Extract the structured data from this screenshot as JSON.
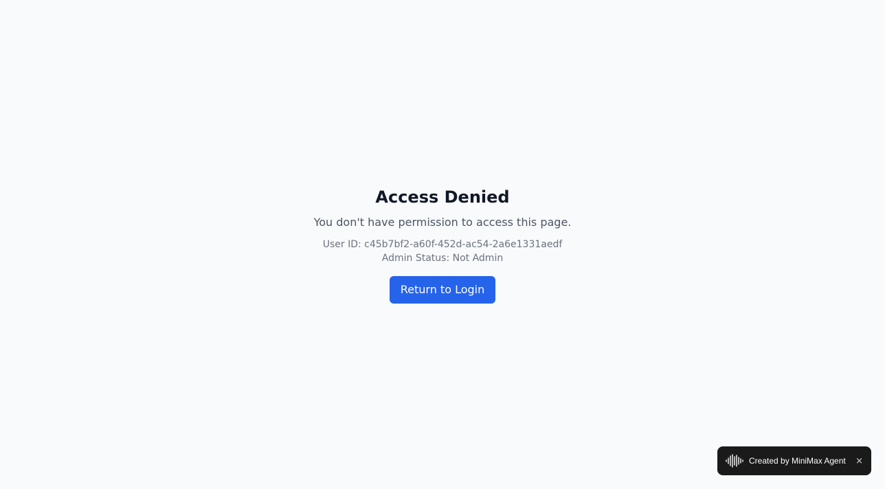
{
  "access": {
    "title": "Access Denied",
    "message": "You don't have permission to access this page.",
    "user_id_line": "User ID: c45b7bf2-a60f-452d-ac54-2a6e1331aedf",
    "admin_status_line": "Admin Status: Not Admin",
    "return_button_label": "Return to Login"
  },
  "badge": {
    "icon": "waveform-icon",
    "text": "Created by MiniMax Agent",
    "close_label": "×"
  },
  "colors": {
    "background": "#f9fafb",
    "primary_button": "#2563eb",
    "title": "#111827",
    "badge_background": "#1a1a1a"
  }
}
